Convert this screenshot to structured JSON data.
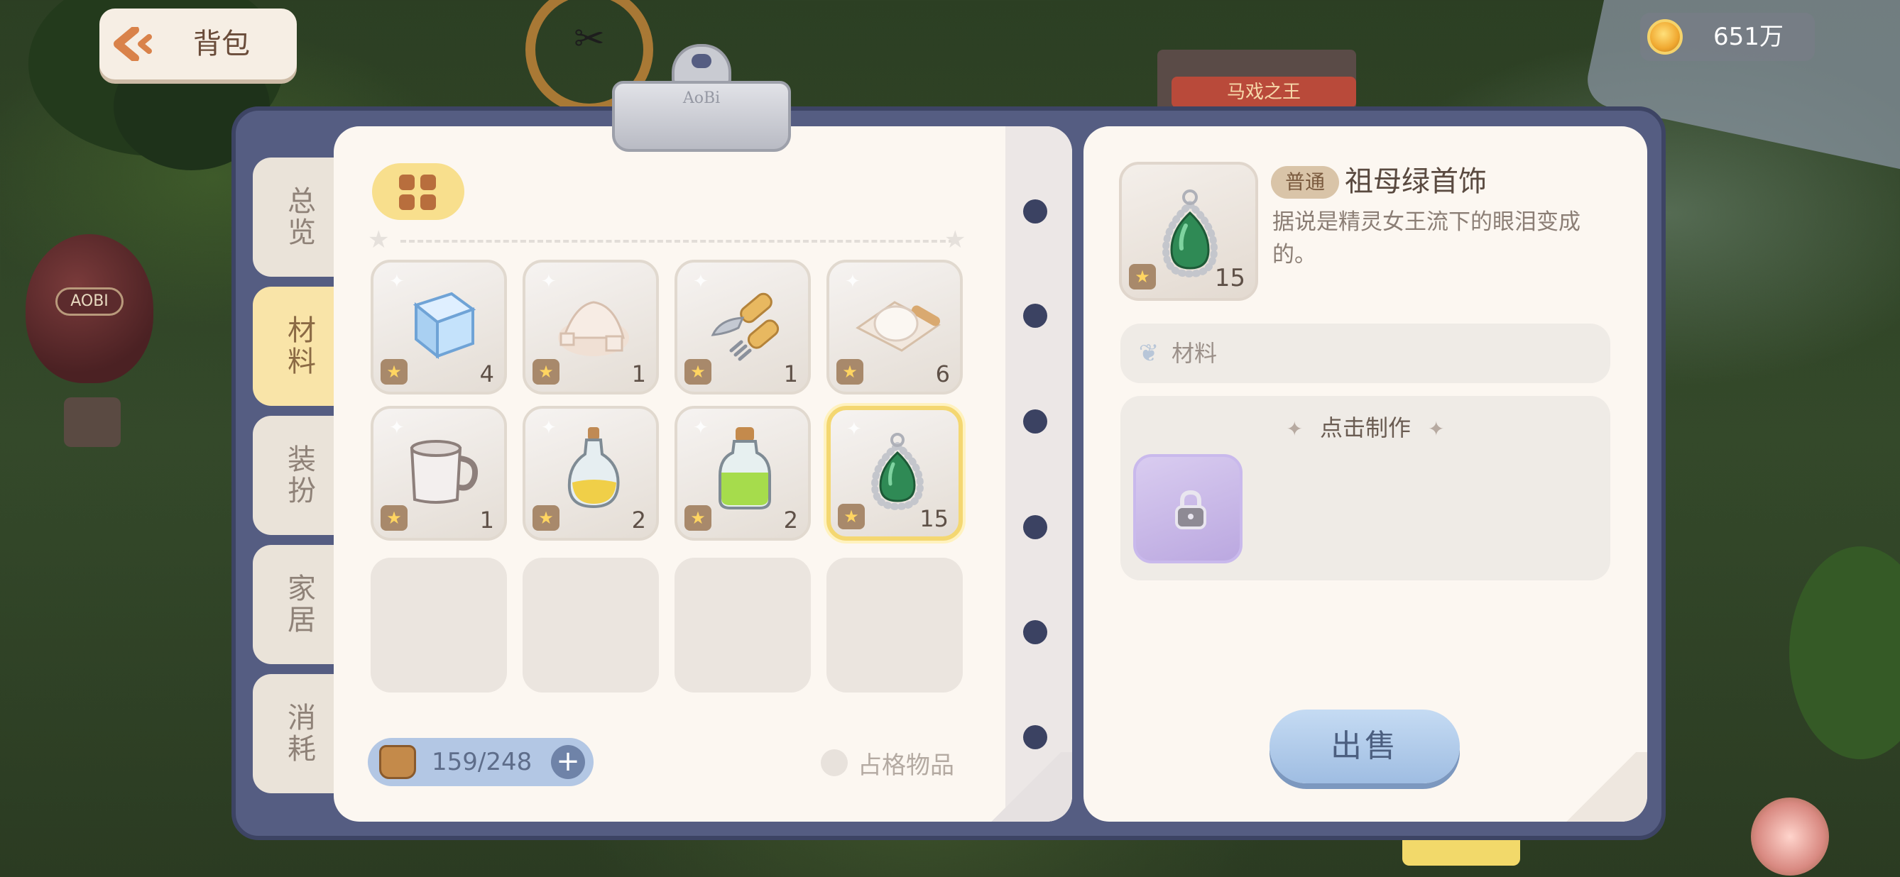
{
  "top_bar": {
    "back_label": "背包",
    "coins": "651万"
  },
  "scene": {
    "balloon_text": "AOBI",
    "circus_sign": "马戏之王"
  },
  "binder": {
    "clip_text": "AoBi"
  },
  "tabs": [
    {
      "label": "总览",
      "active": false
    },
    {
      "label": "材料",
      "active": true
    },
    {
      "label": "装扮",
      "active": false
    },
    {
      "label": "家居",
      "active": false
    },
    {
      "label": "消耗",
      "active": false
    }
  ],
  "inventory": {
    "items": [
      {
        "name": "ice-cube",
        "qty": "4"
      },
      {
        "name": "salt-pile",
        "qty": "1"
      },
      {
        "name": "knife-fork",
        "qty": "1"
      },
      {
        "name": "dough",
        "qty": "6"
      },
      {
        "name": "mug",
        "qty": "1"
      },
      {
        "name": "oil-bottle",
        "qty": "2"
      },
      {
        "name": "green-potion",
        "qty": "2"
      },
      {
        "name": "emerald-pendant",
        "qty": "15",
        "selected": true
      }
    ],
    "capacity": "159/248",
    "occupy_label": "占格物品"
  },
  "detail": {
    "rarity": "普通",
    "name": "祖母绿首饰",
    "description": "据说是精灵女王流下的眼泪变成的。",
    "qty": "15",
    "category": "材料",
    "craft_title": "点击制作",
    "sell_label": "出售"
  },
  "colors": {
    "accent_yellow": "#f8df8d",
    "binder_blue": "#555d82",
    "sell_blue": "#9fbde2",
    "emerald": "#2f8a55"
  }
}
